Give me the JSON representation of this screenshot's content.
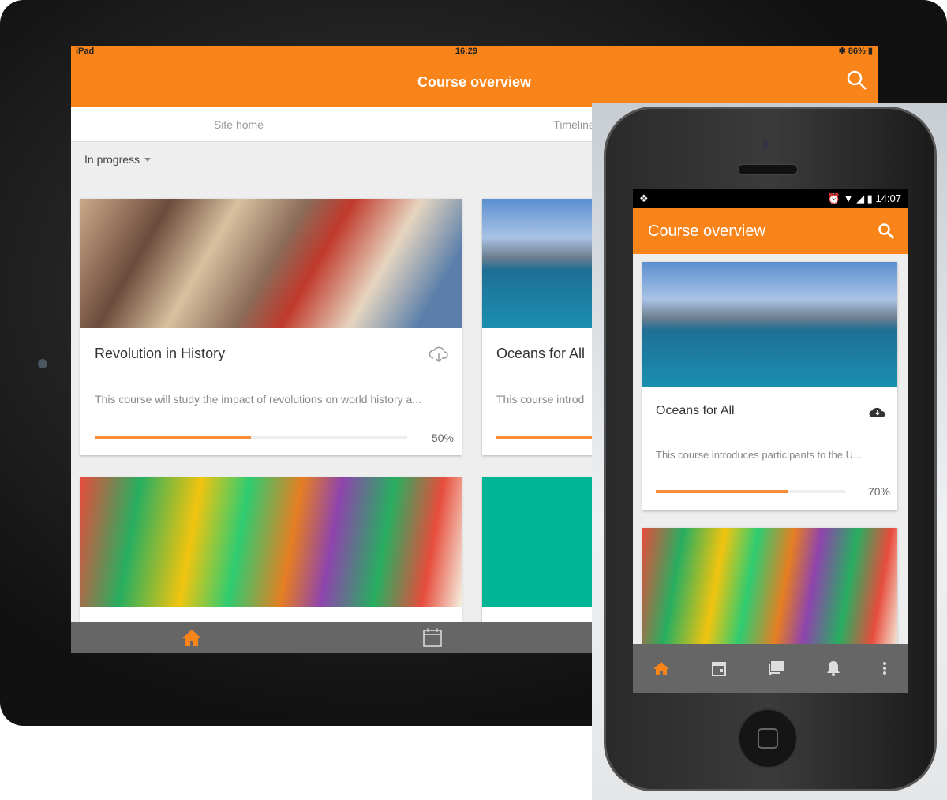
{
  "tablet": {
    "status": {
      "carrier": "iPad",
      "time": "16:29",
      "battery": "86%"
    },
    "header": {
      "title": "Course overview"
    },
    "tabs": [
      {
        "label": "Site home"
      },
      {
        "label": "Timeline"
      }
    ],
    "filter": {
      "selected": "In progress"
    },
    "courses": [
      {
        "title": "Revolution in History",
        "description": "This course will study the impact of revolutions on world history a...",
        "progress": 50,
        "progress_label": "50%"
      },
      {
        "title": "Oceans for All",
        "description": "This course introd",
        "progress": 70
      }
    ]
  },
  "phone": {
    "status": {
      "time": "14:07"
    },
    "header": {
      "title": "Course overview"
    },
    "courses": [
      {
        "title": "Oceans for All",
        "description": "This course introduces participants to the U...",
        "progress": 70,
        "progress_label": "70%"
      }
    ],
    "nav": [
      "home-icon",
      "calendar-icon",
      "messages-icon",
      "notifications-icon",
      "more-icon"
    ]
  },
  "colors": {
    "accent": "#f8841a",
    "progress": "#f98e36",
    "nav": "#666666"
  }
}
